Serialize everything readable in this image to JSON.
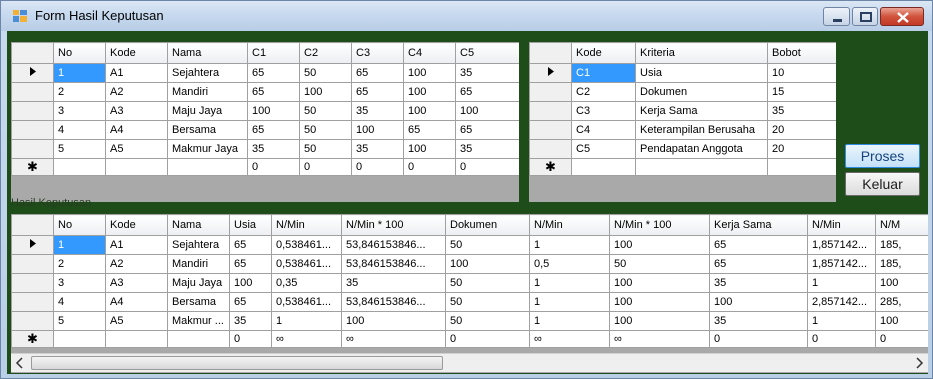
{
  "window": {
    "title": "Form Hasil Keputusan"
  },
  "grid_alternatif": {
    "columns": [
      "No",
      "Kode",
      "Nama",
      "C1",
      "C2",
      "C3",
      "C4",
      "C5"
    ],
    "rows": [
      [
        "1",
        "A1",
        "Sejahtera",
        "65",
        "50",
        "65",
        "100",
        "35"
      ],
      [
        "2",
        "A2",
        "Mandiri",
        "65",
        "100",
        "65",
        "100",
        "65"
      ],
      [
        "3",
        "A3",
        "Maju Jaya",
        "100",
        "50",
        "35",
        "100",
        "100"
      ],
      [
        "4",
        "A4",
        "Bersama",
        "65",
        "50",
        "100",
        "65",
        "65"
      ],
      [
        "5",
        "A5",
        "Makmur Jaya",
        "35",
        "50",
        "35",
        "100",
        "35"
      ]
    ],
    "new_row": [
      "",
      "",
      "",
      "0",
      "0",
      "0",
      "0",
      "0"
    ]
  },
  "grid_kriteria": {
    "columns": [
      "Kode",
      "Kriteria",
      "Bobot"
    ],
    "rows": [
      [
        "C1",
        "Usia",
        "10"
      ],
      [
        "C2",
        "Dokumen",
        "15"
      ],
      [
        "C3",
        "Kerja Sama",
        "35"
      ],
      [
        "C4",
        "Keterampilan Berusaha",
        "20"
      ],
      [
        "C5",
        "Pendapatan Anggota",
        "20"
      ]
    ]
  },
  "buttons": {
    "proses": "Proses",
    "keluar": "Keluar"
  },
  "section_label": "Hasil Keputusan",
  "grid_hasil": {
    "columns": [
      "No",
      "Kode",
      "Nama",
      "Usia",
      "N/Min",
      "N/Min * 100",
      "Dokumen",
      "N/Min",
      "N/Min * 100",
      "Kerja Sama",
      "N/Min",
      "N/M"
    ],
    "rows": [
      [
        "1",
        "A1",
        "Sejahtera",
        "65",
        "0,538461...",
        "53,846153846...",
        "50",
        "1",
        "100",
        "65",
        "1,857142...",
        "185,"
      ],
      [
        "2",
        "A2",
        "Mandiri",
        "65",
        "0,538461...",
        "53,846153846...",
        "100",
        "0,5",
        "50",
        "65",
        "1,857142...",
        "185,"
      ],
      [
        "3",
        "A3",
        "Maju Jaya",
        "100",
        "0,35",
        "35",
        "50",
        "1",
        "100",
        "35",
        "1",
        "100"
      ],
      [
        "4",
        "A4",
        "Bersama",
        "65",
        "0,538461...",
        "53,846153846...",
        "50",
        "1",
        "100",
        "100",
        "2,857142...",
        "285,"
      ],
      [
        "5",
        "A5",
        "Makmur ...",
        "35",
        "1",
        "100",
        "50",
        "1",
        "100",
        "35",
        "1",
        "100"
      ]
    ],
    "new_row": [
      "",
      "",
      "",
      "0",
      "∞",
      "∞",
      "0",
      "∞",
      "∞",
      "0",
      "0",
      "0"
    ]
  },
  "icons": {
    "row_pointer": "triangle-right-icon",
    "new_row": "asterisk-icon"
  }
}
